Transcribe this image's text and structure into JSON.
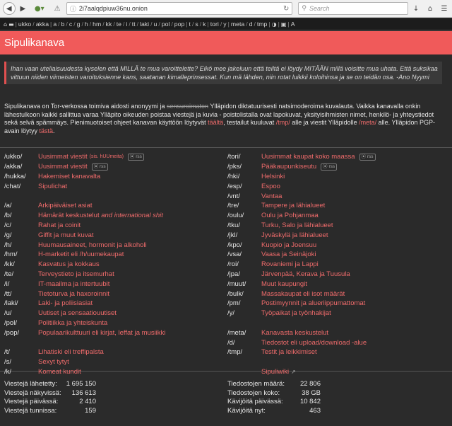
{
  "browser": {
    "url": "2i7aalqdpiuw36nu.onion",
    "search_placeholder": "Search"
  },
  "board_nav": {
    "groups": [
      [
        "ukko",
        "akka"
      ],
      [
        "a",
        "b",
        "c",
        "g",
        "h",
        "hm",
        "kk",
        "te",
        "i",
        "tt",
        "laki",
        "u",
        "pol",
        "pop"
      ],
      [
        "t",
        "s",
        "k"
      ],
      [
        "tori",
        "y"
      ],
      [
        "meta",
        "d",
        "tmp"
      ]
    ],
    "font_icon": "A"
  },
  "title": "Sipulikanava",
  "quote": "Ihan vaan uteliaisuudesta kyselen että MILLÄ te mua varoittelette? Eikö mee jakeluun että teiltä ei löydy MITÄÄN millä voisitte mua uhata. Että suksikaa vittuun niiden viimeisten varoituksienne kans, saatanan kimalleprinsessat. Kun mä lähden, niin rotat luikkii koloihinsa ja se on teidän osa. -Ano Nyymi",
  "intro": {
    "p1": "Sipulikanava on Tor-verkossa toimiva aidosti anonyymi ja ",
    "strike": "sensuroimaton",
    "p2": " Ylläpidon diktatuurisesti natsimoderoima kuvalauta. Vaikka kanavalla onkin lähestulkoon kaikki sallittua varaa Ylläpito oikeuden poistaa viestejä ja kuvia - poistolistalla ovat lapokuvat, yksityisihmisten nimet, henkilö- ja yhteystiedot sekä selvä spämmäys. Pienimuotoiset ohjeet kanavan käyttöön löytyvät ",
    "link1": "täältä",
    "p3": ", testailut kuuluvat ",
    "link2": "/tmp/",
    "p4": " alle ja viestit Ylläpidolle ",
    "link3": "/meta/",
    "p5": " alle. Ylläpidon PGP-avain löytyy ",
    "link4": "tästä",
    "p6": "."
  },
  "boards_left": [
    {
      "code": "/ukko/",
      "name": "Uusimmat viestit",
      "small": "(sis. hUUmeita)",
      "rss": "rss"
    },
    {
      "code": "/akka/",
      "name": "Uusimmat viestit",
      "rss": "rss"
    },
    {
      "code": "/hukka/",
      "name": "Hakemiset kanavalta"
    },
    {
      "code": "/chat/",
      "name": "Sipulichat"
    },
    {
      "gap": true
    },
    {
      "code": "/a/",
      "name": "Arkipäiväiset asiat"
    },
    {
      "code": "/b/",
      "name": "Hämärät keskustelut",
      "italic": "and international shit"
    },
    {
      "code": "/c/",
      "name": "Rahat ja coinit"
    },
    {
      "code": "/g/",
      "name": "Giffit ja muut kuvat"
    },
    {
      "code": "/h/",
      "name": "Huumausaineet, hormonit ja alkoholi"
    },
    {
      "code": "/hm/",
      "name": "H-marketit eli /h/uumekaupat"
    },
    {
      "code": "/kk/",
      "name": "Kasvatus ja kokkaus"
    },
    {
      "code": "/te/",
      "name": "Terveystieto ja itsemurhat"
    },
    {
      "code": "/i/",
      "name": "IT-maailma ja intertuubit"
    },
    {
      "code": "/tt/",
      "name": "Tietoturva ja haxoroinnit"
    },
    {
      "code": "/laki/",
      "name": "Laki- ja poliisiasiat"
    },
    {
      "code": "/u/",
      "name": "Uutiset ja sensaatiouutiset"
    },
    {
      "code": "/pol/",
      "name": "Politiikka ja yhteiskunta"
    },
    {
      "code": "/pop/",
      "name": "Populaarikulttuuri eli kirjat, leffat ja musiikki"
    },
    {
      "gap": true
    },
    {
      "code": "/t/",
      "name": "Lihatiski eli treffipalsta"
    },
    {
      "code": "/s/",
      "name": "Sexyt tytyt"
    },
    {
      "code": "/k/",
      "name": "Komeat kundit"
    }
  ],
  "boards_right": [
    {
      "code": "/tori/",
      "name": "Uusimmat kaupat koko maassa",
      "rss": "rss"
    },
    {
      "code": "/pks/",
      "name": "Pääkaupunkiseutu",
      "rss": "rss"
    },
    {
      "code": "/hki/",
      "name": "Helsinki"
    },
    {
      "code": "/esp/",
      "name": "Espoo"
    },
    {
      "code": "/vnt/",
      "name": "Vantaa"
    },
    {
      "code": "/tre/",
      "name": "Tampere ja lähialueet"
    },
    {
      "code": "/oulu/",
      "name": "Oulu ja Pohjanmaa"
    },
    {
      "code": "/tku/",
      "name": "Turku, Salo ja lähialueet"
    },
    {
      "code": "/jkl/",
      "name": "Jyväskylä ja lähialueet"
    },
    {
      "code": "/kpo/",
      "name": "Kuopio ja Joensuu"
    },
    {
      "code": "/vsa/",
      "name": "Vaasa ja Seinäjoki"
    },
    {
      "code": "/roi/",
      "name": "Rovaniemi ja Lappi"
    },
    {
      "code": "/jpa/",
      "name": "Järvenpää, Kerava ja Tuusula"
    },
    {
      "code": "/muut/",
      "name": "Muut kaupungit"
    },
    {
      "code": "/bulk/",
      "name": "Massakaupat eli isot määrät"
    },
    {
      "code": "/pm/",
      "name": "Postimyynnit ja alueriippumattomat"
    },
    {
      "code": "/y/",
      "name": "Työpaikat ja työnhakijat"
    },
    {
      "gap": true
    },
    {
      "code": "/meta/",
      "name": "Kanavasta keskustelut"
    },
    {
      "code": "/d/",
      "name": "Tiedostot eli upload/download -alue"
    },
    {
      "code": "/tmp/",
      "name": "Testit ja leikkimiset"
    },
    {
      "gap": true
    },
    {
      "code": "",
      "name": "Sipuliwiki",
      "ext": true
    }
  ],
  "stats_left": [
    {
      "label": "Viestejä lähetetty:",
      "value": "1 695 150"
    },
    {
      "label": "Viestejä näkyvissä:",
      "value": "136 613"
    },
    {
      "label": "Viestejä päivässä:",
      "value": "2 410"
    },
    {
      "label": "Viestejä tunnissa:",
      "value": "159"
    }
  ],
  "stats_right": [
    {
      "label": "Tiedostojen määrä:",
      "value": "22 806"
    },
    {
      "label": "Tiedostojen koko:",
      "value": "38 GB"
    },
    {
      "label": "Kävijöitä päivässä:",
      "value": "10 842"
    },
    {
      "label": "Kävijöitä nyt:",
      "value": "463"
    }
  ]
}
